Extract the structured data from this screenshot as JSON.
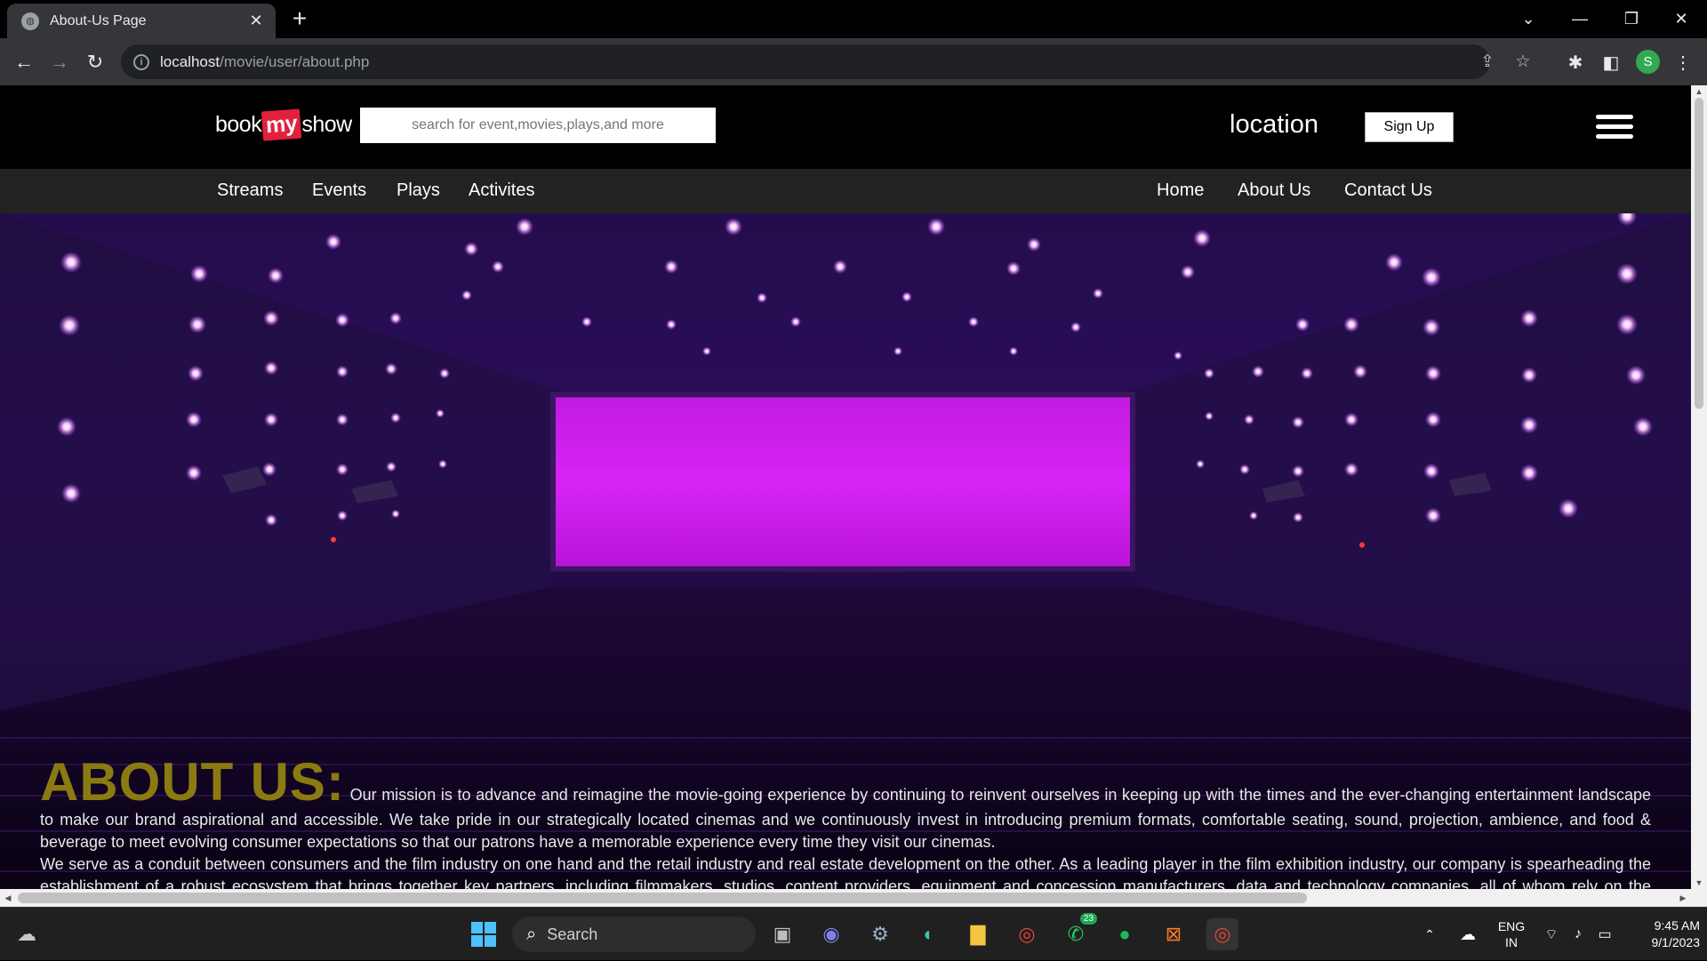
{
  "browser": {
    "tab_title": "About-Us Page",
    "url_host": "localhost",
    "url_path": "/movie/user/about.php",
    "profile_initial": "S"
  },
  "site": {
    "logo": {
      "part1": "book",
      "part2": "my",
      "part3": "show"
    },
    "search_placeholder": "search for event,movies,plays,and more",
    "location_label": "location",
    "signup_label": "Sign Up",
    "nav_left": [
      "Streams",
      "Events",
      "Plays",
      "Activites"
    ],
    "nav_right": [
      "Home",
      "About Us",
      "Contact Us"
    ]
  },
  "about": {
    "title": "ABOUT US:",
    "paragraph1": "Our mission is to advance and reimagine the movie-going experience by continuing to reinvent ourselves in keeping up with the times and the ever-changing entertainment landscape to make our brand aspirational and accessible. We take pride in our strategically located cinemas and we continuously invest in introducing premium formats, comfortable seating, sound, projection, ambience, and food & beverage to meet evolving consumer expectations so that our patrons have a memorable experience every time they visit our cinemas.",
    "paragraph2": "We serve as a conduit between consumers and the film industry on one hand and the retail industry and real estate development on the other. As a leading player in the film exhibition industry, our company is spearheading the establishment of a robust ecosystem that brings together key partners, including filmmakers, studios, content providers, equipment and concession manufacturers, data and technology companies, all of whom rely on the strength of our business and the communities we serve. We engage with multiple channels to connect with our over 180 million patrons through research, loyalty, online, digital, and offline modes to provide a platform to showcase film and non-film content and identifying new trends in the film exhibition industry."
  },
  "taskbar": {
    "search_label": "Search",
    "whatsapp_badge": "23",
    "lang_line1": "ENG",
    "lang_line2": "IN",
    "time": "9:45 AM",
    "date": "9/1/2023"
  },
  "colors": {
    "about_title": "#8a7a12",
    "hero_purple": "#2a0c52",
    "screen_magenta": "#d21cf0",
    "nav_bar": "#222222"
  }
}
